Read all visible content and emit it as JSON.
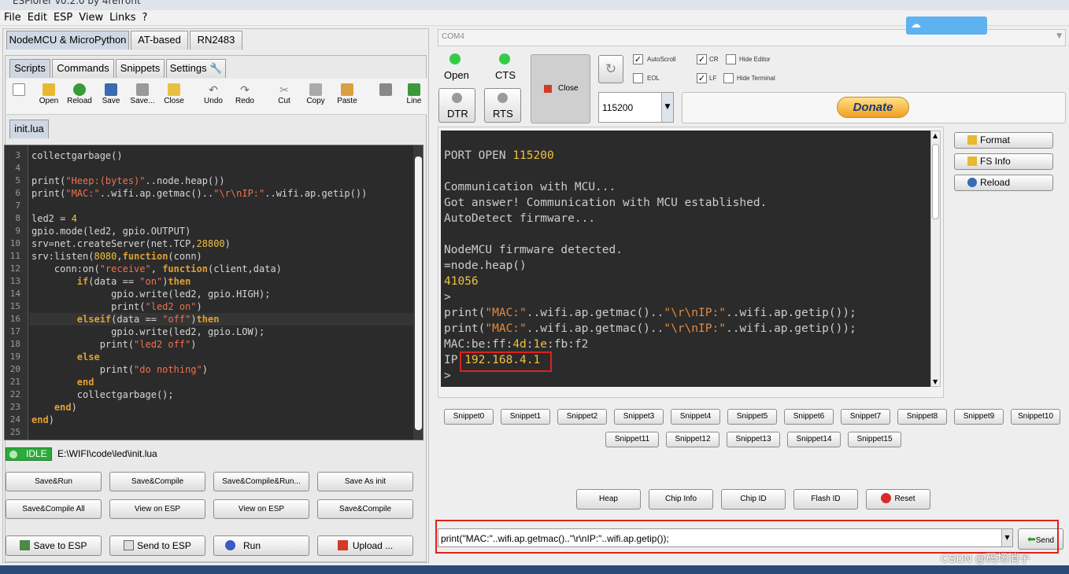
{
  "window": {
    "title": "ESPlorer v0.2.0 by 4refr0nt"
  },
  "menu": [
    "File",
    "Edit",
    "ESP",
    "View",
    "Links",
    "?"
  ],
  "top_tabs": [
    "NodeMCU & MicroPython",
    "AT-based",
    "RN2483"
  ],
  "sub_tabs": [
    "Scripts",
    "Commands",
    "Snippets",
    "Settings"
  ],
  "toolbar": [
    "Open",
    "Reload",
    "Save",
    "Save...",
    "Close",
    "Undo",
    "Redo",
    "Cut",
    "Copy",
    "Paste",
    "Line"
  ],
  "file_tab": "init.lua",
  "code_lines": [
    {
      "n": "3",
      "html": "collectgarbage()"
    },
    {
      "n": "4",
      "html": ""
    },
    {
      "n": "5",
      "html": "print(<span class=\"str\">\"Heep:(bytes)\"</span>..node.heap())"
    },
    {
      "n": "6",
      "html": "print(<span class=\"str\">\"MAC:\"</span>..wifi.ap.getmac()..<span class=\"str\">\"\\r\\nIP:\"</span>..wifi.ap.getip())"
    },
    {
      "n": "7",
      "html": ""
    },
    {
      "n": "8",
      "html": "led2 = <span class=\"num\">4</span>"
    },
    {
      "n": "9",
      "html": "gpio.mode(led2, gpio.OUTPUT)"
    },
    {
      "n": "10",
      "html": "srv=net.createServer(net.TCP,<span class=\"num\">28800</span>)"
    },
    {
      "n": "11",
      "html": "srv:listen(<span class=\"num\">8080</span>,<span class=\"kw\">function</span>(conn)"
    },
    {
      "n": "12",
      "html": "    conn:on(<span class=\"str\">\"receive\"</span>, <span class=\"kw\">function</span>(client,data)"
    },
    {
      "n": "13",
      "html": "        <span class=\"kw\">if</span>(data == <span class=\"str\">\"on\"</span>)<span class=\"kw\">then</span>"
    },
    {
      "n": "14",
      "html": "              gpio.write(led2, gpio.HIGH);"
    },
    {
      "n": "15",
      "html": "              print(<span class=\"str\">\"led2 on\"</span>)"
    },
    {
      "n": "16",
      "html": "        <span class=\"kw\">elseif</span>(data == <span class=\"str\">\"off\"</span>)<span class=\"kw\">then</span>"
    },
    {
      "n": "17",
      "html": "              gpio.write(led2, gpio.LOW);"
    },
    {
      "n": "18",
      "html": "            print(<span class=\"str\">\"led2 off\"</span>)"
    },
    {
      "n": "19",
      "html": "        <span class=\"kw\">else</span>"
    },
    {
      "n": "20",
      "html": "            print(<span class=\"str\">\"do nothing\"</span>)"
    },
    {
      "n": "21",
      "html": "        <span class=\"kw\">end</span>"
    },
    {
      "n": "22",
      "html": "        collectgarbage();"
    },
    {
      "n": "23",
      "html": "    <span class=\"kw\">end</span>)"
    },
    {
      "n": "24",
      "html": "<span class=\"kw\">end</span>)"
    },
    {
      "n": "25",
      "html": ""
    }
  ],
  "status": {
    "state": "IDLE",
    "path": "E:\\WIFI\\code\\led\\init.lua"
  },
  "left_buttons_row1": [
    "Save&Run",
    "Save&Compile",
    "Save&Compile&Run...",
    "Save As init"
  ],
  "left_buttons_row2": [
    "Save&Compile All",
    "View on ESP",
    "View on ESP",
    "Save&Compile"
  ],
  "left_buttons_row3": [
    "Save to ESP",
    "Send to ESP",
    "Run",
    "Upload ..."
  ],
  "port": {
    "name": "COM4",
    "open": "Open",
    "cts": "CTS",
    "dtr": "DTR",
    "rts": "RTS",
    "close": "Close",
    "baud": "115200"
  },
  "options": {
    "autoscroll": "AutoScroll",
    "eol": "EOL",
    "cr": "CR",
    "lf": "LF",
    "hide_editor": "Hide Editor",
    "hide_terminal": "Hide Terminal"
  },
  "donate": "Donate",
  "side_buttons": [
    "Format",
    "FS Info",
    "Reload"
  ],
  "terminal_lines": [
    {
      "html": ""
    },
    {
      "html": "PORT OPEN <span class=\"yl\">115200</span>"
    },
    {
      "html": ""
    },
    {
      "html": "Communication with MCU..."
    },
    {
      "html": "Got answer! Communication with MCU established."
    },
    {
      "html": "AutoDetect firmware..."
    },
    {
      "html": ""
    },
    {
      "html": "NodeMCU firmware detected."
    },
    {
      "html": "=node.heap()"
    },
    {
      "html": "<span class=\"yl\">41056</span>"
    },
    {
      "html": "&gt;"
    },
    {
      "html": "print(<span class=\"or\">\"MAC:\"</span>..wifi.ap.getmac()..<span class=\"or\">\"\\r\\nIP:\"</span>..wifi.ap.getip());"
    },
    {
      "html": "print(<span class=\"or\">\"MAC:\"</span>..wifi.ap.getmac()..<span class=\"or\">\"\\r\\nIP:\"</span>..wifi.ap.getip());"
    },
    {
      "html": "MAC:be:ff:<span class=\"yl\">4d</span>:<span class=\"yl\">1e</span>:fb:f2"
    },
    {
      "html": "IP <span class=\"yl\">192.168.4.1</span>"
    },
    {
      "html": "&gt;"
    }
  ],
  "snippets_row1": [
    "Snippet0",
    "Snippet1",
    "Snippet2",
    "Snippet3",
    "Snippet4",
    "Snippet5",
    "Snippet6",
    "Snippet7",
    "Snippet8",
    "Snippet9",
    "Snippet10"
  ],
  "snippets_row2": [
    "Snippet11",
    "Snippet12",
    "Snippet13",
    "Snippet14",
    "Snippet15"
  ],
  "cmd_buttons": [
    "Heap",
    "Chip Info",
    "Chip ID",
    "Flash ID",
    "Reset"
  ],
  "command_input": "print(\"MAC:\"..wifi.ap.getmac()..\"\\r\\nIP:\"..wifi.ap.getip());",
  "send": "Send",
  "watermark": "CSDN @码场消子",
  "colors": {
    "editor_bg": "#2b2b2b",
    "keyword": "#e0a030",
    "string": "#f07050",
    "number": "#f0c040",
    "highlight": "#e0201c"
  }
}
